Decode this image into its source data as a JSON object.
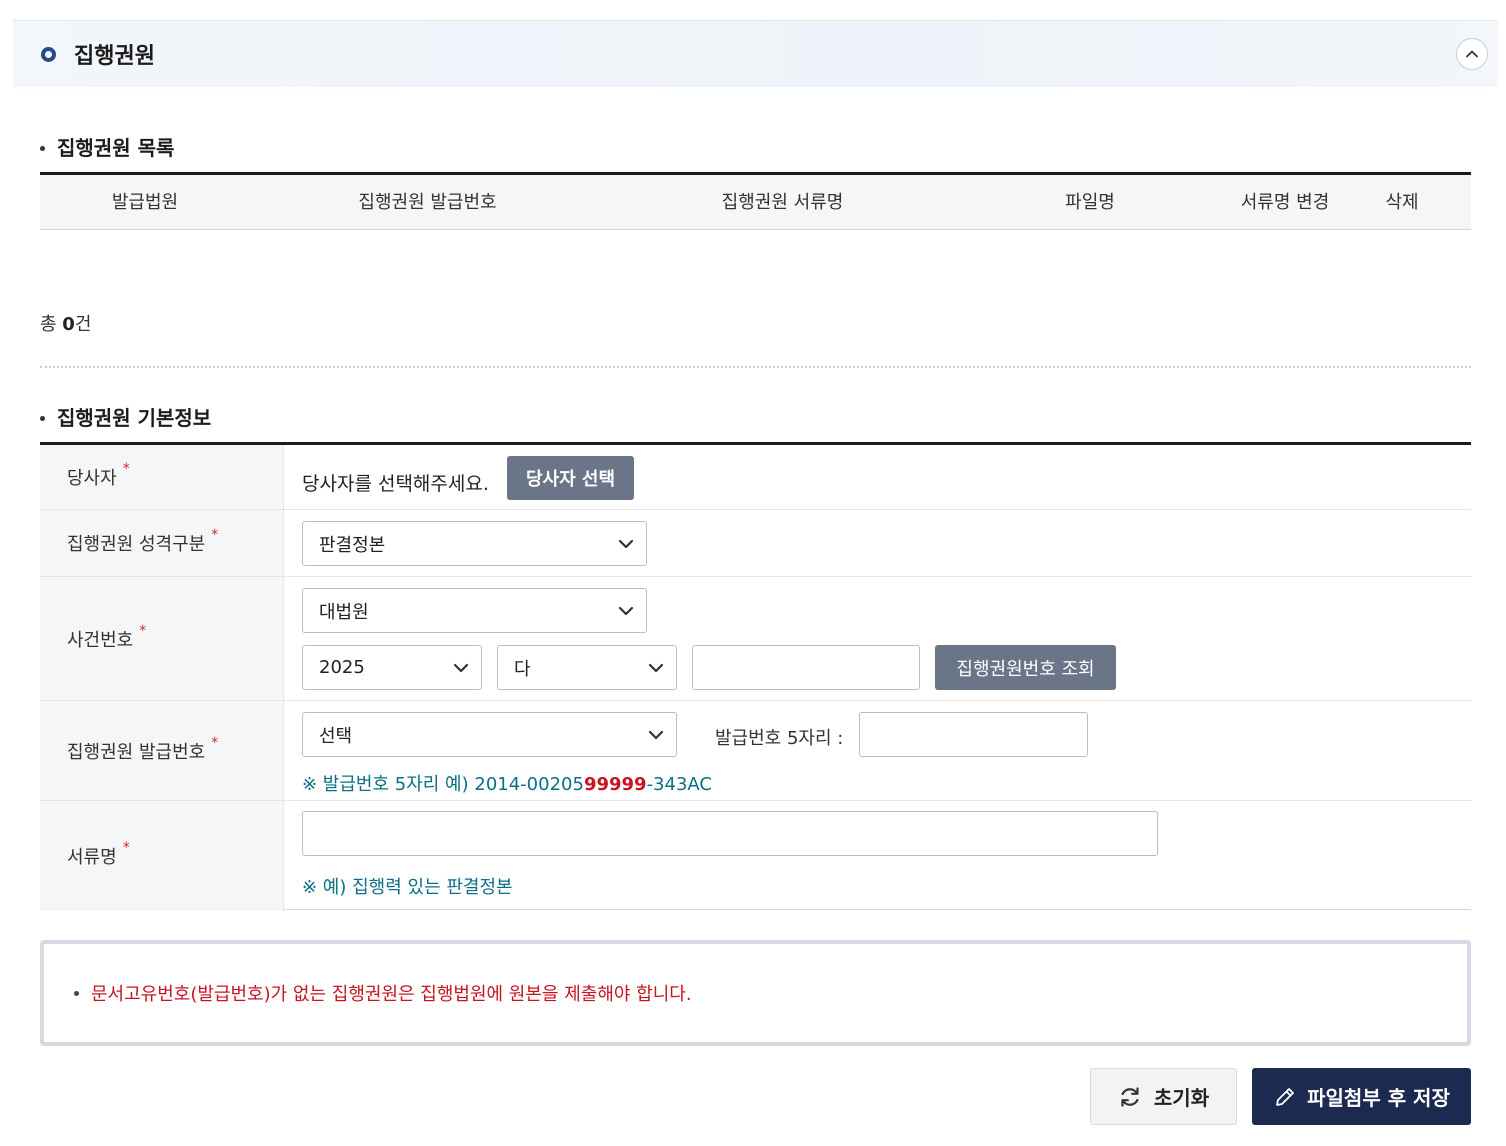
{
  "panel": {
    "title": "집행권원"
  },
  "list_section": {
    "title": "집행권원 목록",
    "columns": [
      "발급법원",
      "집행권원 발급번호",
      "집행권원 서류명",
      "파일명",
      "서류명 변경",
      "삭제"
    ],
    "total_prefix": "총 ",
    "total_count": "0",
    "total_suffix": "건"
  },
  "form_section": {
    "title": "집행권원 기본정보",
    "required_mark": "*",
    "party": {
      "label": "당사자",
      "placeholder_text": "당사자를 선택해주세요.",
      "select_button": "당사자 선택"
    },
    "nature": {
      "label": "집행권원 성격구분",
      "selected": "판결정본"
    },
    "case_number": {
      "label": "사건번호",
      "court_selected": "대법원",
      "year_selected": "2025",
      "type_selected": "다",
      "number_value": "",
      "lookup_button": "집행권원번호 조회"
    },
    "issue_number": {
      "label": "집행권원 발급번호",
      "selected": "선택",
      "five_digit_label": "발급번호 5자리 :",
      "five_digit_value": "",
      "hint_prefix": "※ 발급번호 5자리 예) 2014-00205",
      "hint_highlight": "99999",
      "hint_suffix": "-343AC"
    },
    "document_name": {
      "label": "서류명",
      "value": "",
      "hint": "※ 예) 집행력 있는 판결정본"
    }
  },
  "notice": {
    "text": "문서고유번호(발급번호)가 없는 집행권원은 집행법원에 원본을 제출해야 합니다."
  },
  "actions": {
    "reset_label": "초기화",
    "save_label": "파일첨부 후 저장"
  },
  "colors": {
    "navy": "#1b2a4e",
    "slate_button": "#6a7587",
    "hint_teal": "#0b6f86",
    "alert_red": "#c8141e"
  }
}
